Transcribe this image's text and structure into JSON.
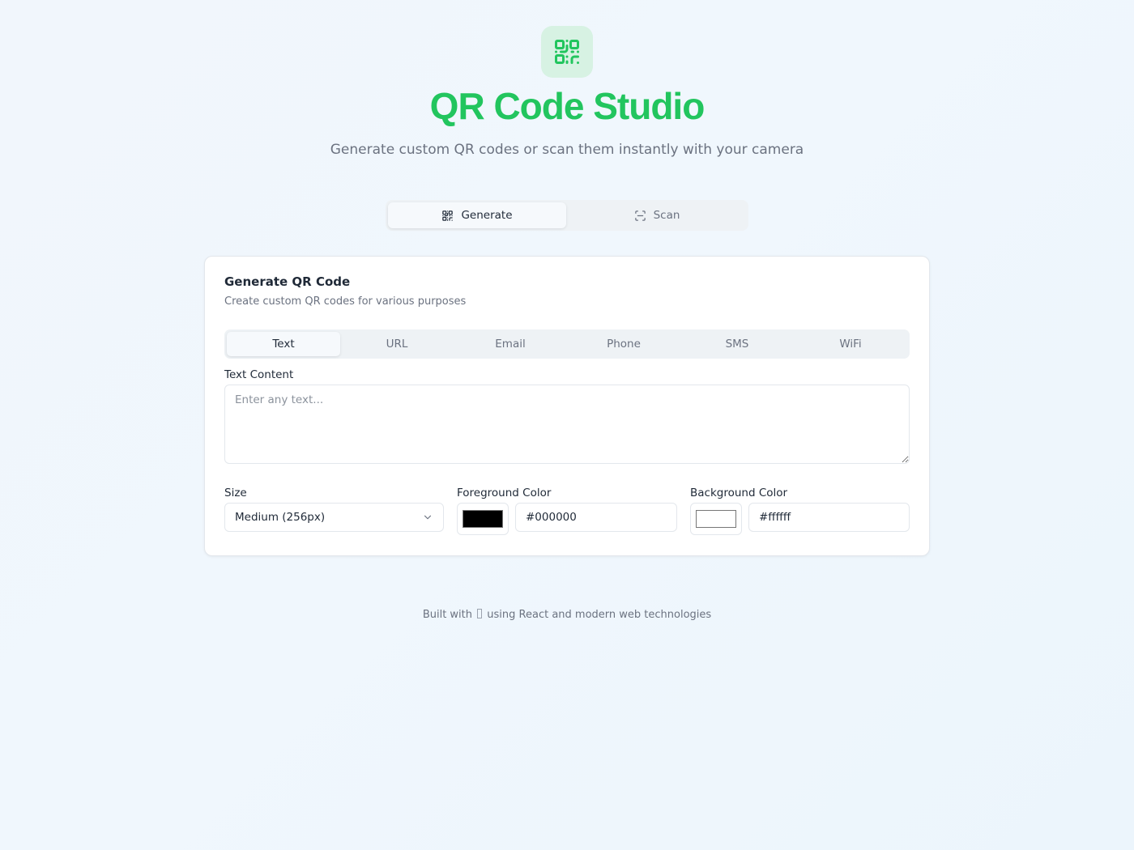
{
  "header": {
    "logo_icon": "qr-code-icon",
    "title": "QR Code Studio",
    "subtitle": "Generate custom QR codes or scan them instantly with your camera",
    "accent_color": "#22c55e"
  },
  "mode_tabs": [
    {
      "label": "Generate",
      "icon": "qr-code-icon",
      "active": true
    },
    {
      "label": "Scan",
      "icon": "scan-icon",
      "active": false
    }
  ],
  "card": {
    "title": "Generate QR Code",
    "description": "Create custom QR codes for various purposes",
    "type_tabs": [
      "Text",
      "URL",
      "Email",
      "Phone",
      "SMS",
      "WiFi"
    ],
    "active_type": "Text",
    "text_content": {
      "label": "Text Content",
      "placeholder": "Enter any text...",
      "value": ""
    },
    "size": {
      "label": "Size",
      "value": "Medium (256px)"
    },
    "foreground": {
      "label": "Foreground Color",
      "value": "#000000"
    },
    "background": {
      "label": "Background Color",
      "value": "#ffffff"
    }
  },
  "footer": {
    "prefix": "Built with",
    "suffix": "using React and modern web technologies"
  }
}
